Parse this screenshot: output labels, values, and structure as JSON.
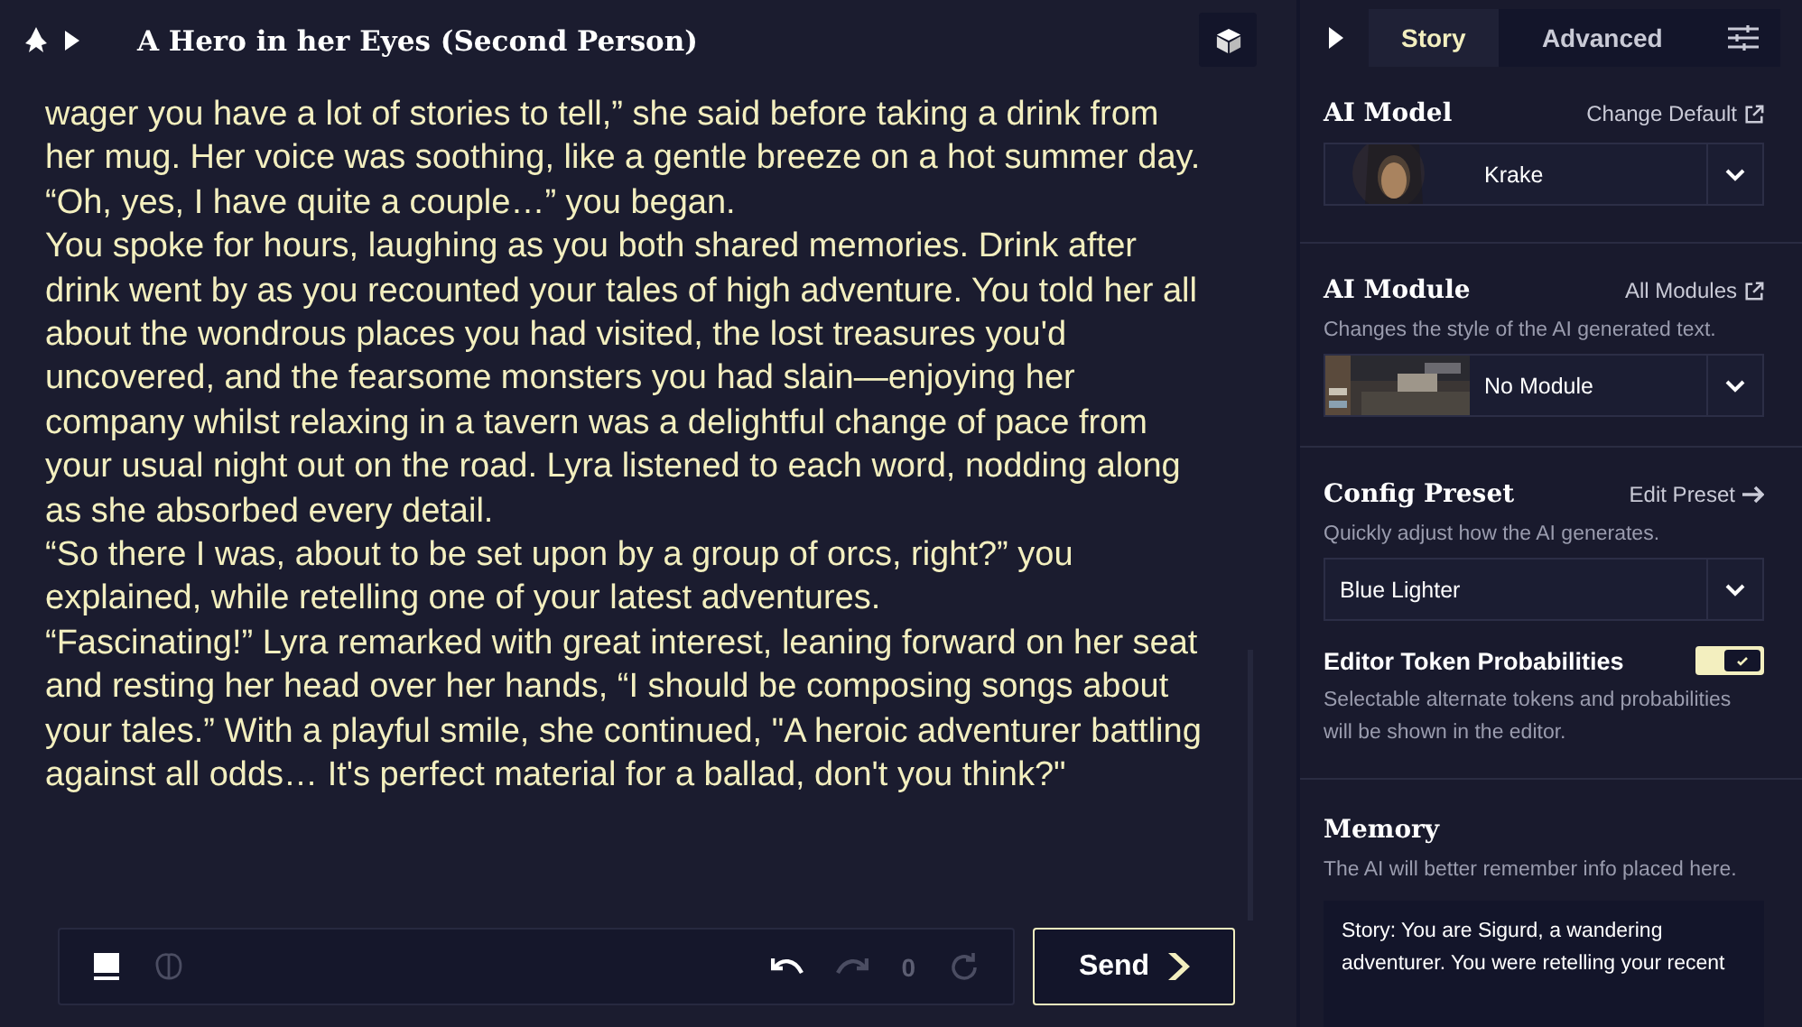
{
  "story": {
    "title": "A Hero in her Eyes (Second Person)",
    "paragraphs": [
      "wager you have a lot of stories to tell,” she said before taking a drink from her mug. Her voice was soothing, like a gentle breeze on a hot summer day.",
      "“Oh, yes, I have quite a couple…” you began.",
      "You spoke for hours, laughing as you both shared memories. Drink after drink went by as you recounted your tales of high adventure. You told her all about the wondrous places you had visited, the lost treasures you'd uncovered, and the fearsome monsters you had slain—enjoying her company whilst relaxing in a tavern was a delightful change of pace from your usual night out on the road. Lyra listened to each word, nodding along as she absorbed every detail.",
      "“So there I was, about to be set upon by a group of orcs, right?” you explained, while retelling one of your latest adventures.",
      "“Fascinating!” Lyra remarked with great interest, leaning forward on her seat and resting her head over her hands, “I should be composing songs about your tales.” With a playful smile, she continued, \"A heroic adventurer battling against all odds… It's perfect material for a ballad, don't you think?\""
    ]
  },
  "toolbar": {
    "count": "0",
    "send": "Send"
  },
  "tabs": [
    {
      "label": "Story",
      "selected": true
    },
    {
      "label": "Advanced",
      "selected": false
    }
  ],
  "sidebar": {
    "model": {
      "title": "AI Model",
      "link": "Change Default",
      "value": "Krake"
    },
    "module": {
      "title": "AI Module",
      "link": "All Modules",
      "description": "Changes the style of the AI generated text.",
      "value": "No Module"
    },
    "preset": {
      "title": "Config Preset",
      "link": "Edit Preset",
      "description": "Quickly adjust how the AI generates.",
      "value": "Blue Lighter"
    },
    "token_probabilities": {
      "label": "Editor Token Probabilities",
      "on": true,
      "description": "Selectable alternate tokens and probabilities will be shown in the editor."
    },
    "memory": {
      "title": "Memory",
      "description": "The AI will better remember info placed here.",
      "value": "Story: You are Sigurd, a wandering adventurer. You were retelling your recent"
    }
  }
}
